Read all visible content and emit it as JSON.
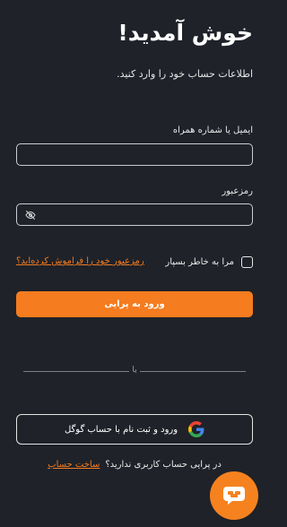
{
  "header": {
    "title": "خوش آمدید!",
    "subtitle": "اطلاعات حساب خود را وارد کنید."
  },
  "form": {
    "email_label": "ایمیل یا شماره همراه",
    "email_value": "",
    "password_label": "رمزعبور",
    "password_value": "",
    "remember_label": "مرا به خاطر بسپار",
    "remember_checked": false,
    "forgot_label": "رمزعبور خود را فراموش کرده‌اید؟",
    "login_button": "ورود به پرایی"
  },
  "divider": {
    "text": "یا"
  },
  "google": {
    "label": "ورود و ثبت نام با حساب گوگل"
  },
  "signup": {
    "question": "در پرایی حساب کاربری ندارید؟",
    "link": "ساخت حساب"
  },
  "colors": {
    "background": "#1f2229",
    "accent": "#f57c1f",
    "text": "#ffffff"
  },
  "icons": {
    "password_toggle": "eye-slash-icon",
    "google": "google-icon",
    "support": "chat-support-icon"
  }
}
